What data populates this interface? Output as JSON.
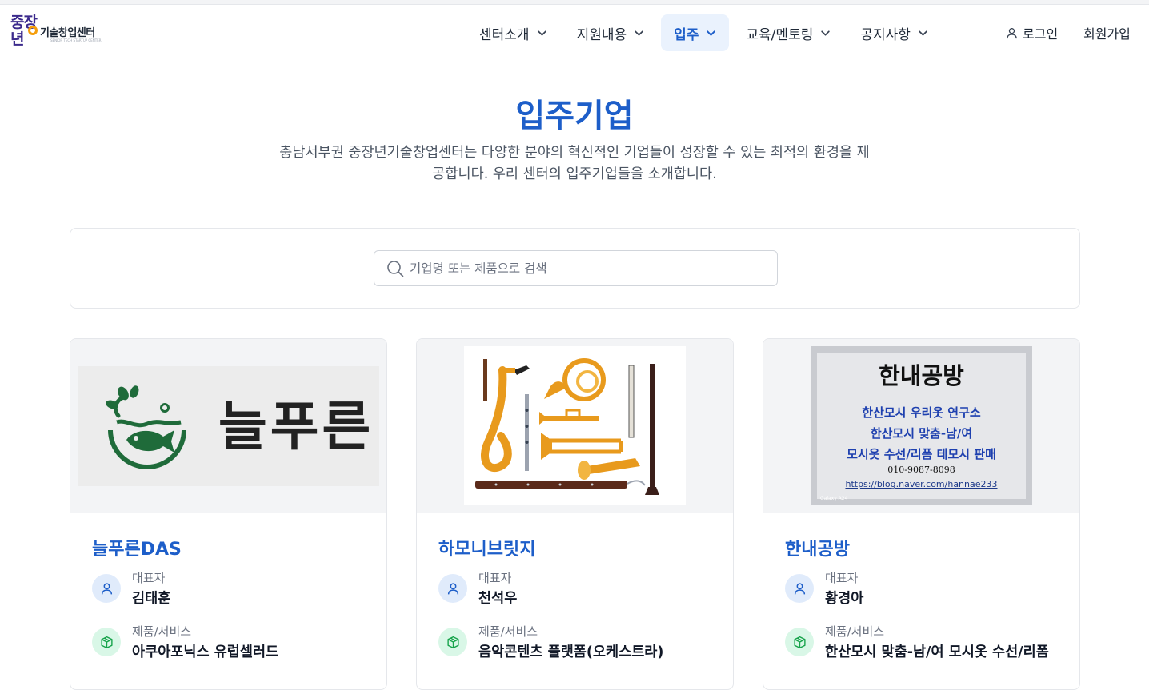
{
  "header": {
    "logo": {
      "big_top": "중장",
      "big_bottom": "년",
      "sub": "기술창업센터",
      "tiny": "SENIOR TECH STARTUP CENTER"
    },
    "nav": [
      {
        "label": "센터소개",
        "active": false
      },
      {
        "label": "지원내용",
        "active": false
      },
      {
        "label": "입주",
        "active": true
      },
      {
        "label": "교육/멘토링",
        "active": false
      },
      {
        "label": "공지사항",
        "active": false
      }
    ],
    "login_label": "로그인",
    "signup_label": "회원가입"
  },
  "hero": {
    "title": "입주기업",
    "desc_line1": "충남서부권 중장년기술창업센터는 다양한 분야의 혁신적인 기업들이 성장할 수 있는 최적의 환경을 제",
    "desc_line2": "공합니다. 우리 센터의 입주기업들을 소개합니다."
  },
  "search": {
    "value": "",
    "placeholder": "기업명 또는 제품으로 검색"
  },
  "companies": [
    {
      "name": "늘푸른DAS",
      "ceo_label": "대표자",
      "ceo": "김태훈",
      "product_label": "제품/서비스",
      "product": "아쿠아포닉스 유럽셀러드",
      "image": {
        "logo_text": "늘푸른"
      }
    },
    {
      "name": "하모니브릿지",
      "ceo_label": "대표자",
      "ceo": "천석우",
      "product_label": "제품/서비스",
      "product": "음악콘텐츠 플랫폼(오케스트라)",
      "image": {
        "subject": "instruments"
      }
    },
    {
      "name": "한내공방",
      "ceo_label": "대표자",
      "ceo": "황경아",
      "product_label": "제품/서비스",
      "product": "한산모시 맞춤-남/여 모시옷 수선/리폼",
      "image": {
        "title": "한내공방",
        "line1": "한산모시 우리옷 연구소",
        "line2": "한산모시 맞춤-남/여",
        "line3": "모시옷 수선/리폼 테모시 판매",
        "phone": "010-9087-8098",
        "url": "https://blog.naver.com/hannae233",
        "watermark": "Galaxy A24"
      }
    }
  ],
  "colors": {
    "accent": "#1d5ec9",
    "nav_active_bg": "#eaf2fd",
    "person_icon_bg": "#e0ebfb",
    "box_icon_bg": "#d9f7e7",
    "box_icon": "#16a34a"
  }
}
